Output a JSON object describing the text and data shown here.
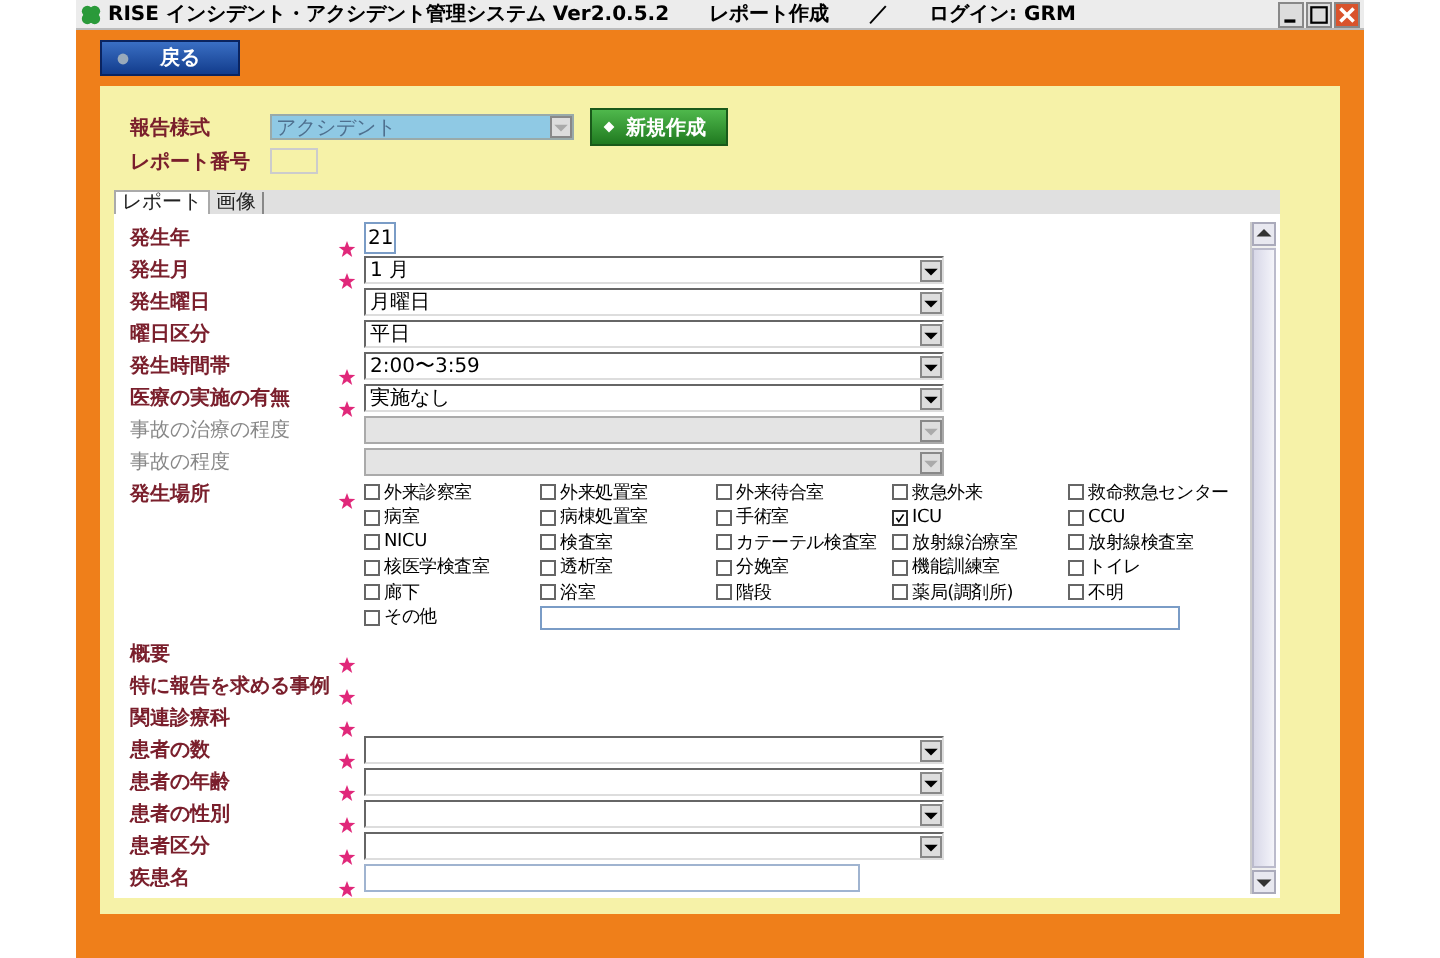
{
  "window": {
    "title": "RISE インシデント・アクシデント管理システム Ver2.0.5.2　　レポート作成　　／　　ログイン: GRM"
  },
  "back_button": "戻る",
  "report_type": {
    "label": "報告様式",
    "value": "アクシデント",
    "disabled": true
  },
  "new_button": "新規作成",
  "report_number": {
    "label": "レポート番号"
  },
  "tabs": [
    {
      "label": "レポート",
      "selected": true
    },
    {
      "label": "画像",
      "selected": false
    }
  ],
  "fields": [
    {
      "kind": "text",
      "label": "発生年",
      "required": true,
      "disabled": false,
      "value": "21"
    },
    {
      "kind": "select",
      "label": "発生月",
      "required": true,
      "disabled": false,
      "value": "1 月"
    },
    {
      "kind": "select",
      "label": "発生曜日",
      "required": false,
      "disabled": false,
      "value": "月曜日"
    },
    {
      "kind": "select",
      "label": "曜日区分",
      "required": false,
      "disabled": false,
      "value": "平日"
    },
    {
      "kind": "select",
      "label": "発生時間帯",
      "required": true,
      "disabled": false,
      "value": "2:00〜3:59"
    },
    {
      "kind": "select",
      "label": "医療の実施の有無",
      "required": true,
      "disabled": false,
      "value": "実施なし"
    },
    {
      "kind": "select",
      "label": "事故の治療の程度",
      "required": false,
      "disabled": true
    },
    {
      "kind": "select",
      "label": "事故の程度",
      "required": false,
      "disabled": true
    },
    {
      "kind": "checkgrid",
      "label": "発生場所",
      "required": true,
      "disabled": false,
      "options": [
        {
          "label": "外来診察室",
          "checked": false
        },
        {
          "label": "外来処置室",
          "checked": false
        },
        {
          "label": "外来待合室",
          "checked": false
        },
        {
          "label": "救急外来",
          "checked": false
        },
        {
          "label": "救命救急センター",
          "checked": false
        },
        {
          "label": "病室",
          "checked": false
        },
        {
          "label": "病棟処置室",
          "checked": false
        },
        {
          "label": "手術室",
          "checked": false
        },
        {
          "label": "ICU",
          "checked": true
        },
        {
          "label": "CCU",
          "checked": false
        },
        {
          "label": "NICU",
          "checked": false
        },
        {
          "label": "検査室",
          "checked": false
        },
        {
          "label": "カテーテル検査室",
          "checked": false
        },
        {
          "label": "放射線治療室",
          "checked": false
        },
        {
          "label": "放射線検査室",
          "checked": false
        },
        {
          "label": "核医学検査室",
          "checked": false
        },
        {
          "label": "透析室",
          "checked": false
        },
        {
          "label": "分娩室",
          "checked": false
        },
        {
          "label": "機能訓練室",
          "checked": false
        },
        {
          "label": "トイレ",
          "checked": false
        },
        {
          "label": "廊下",
          "checked": false
        },
        {
          "label": "浴室",
          "checked": false
        },
        {
          "label": "階段",
          "checked": false
        },
        {
          "label": "薬局(調剤所)",
          "checked": false
        },
        {
          "label": "不明",
          "checked": false
        },
        {
          "label": "その他",
          "checked": false
        }
      ]
    },
    {
      "kind": "none",
      "label": "概要",
      "required": true,
      "disabled": false
    },
    {
      "kind": "none",
      "label": "特に報告を求める事例",
      "required": true,
      "disabled": false
    },
    {
      "kind": "none",
      "label": "関連診療科",
      "required": true,
      "disabled": false
    },
    {
      "kind": "select",
      "label": "患者の数",
      "required": true,
      "disabled": false
    },
    {
      "kind": "select",
      "label": "患者の年齢",
      "required": true,
      "disabled": false
    },
    {
      "kind": "select",
      "label": "患者の性別",
      "required": true,
      "disabled": false
    },
    {
      "kind": "select",
      "label": "患者区分",
      "required": true,
      "disabled": false
    },
    {
      "kind": "wide-text",
      "label": "疾患名",
      "required": true,
      "disabled": false
    }
  ]
}
